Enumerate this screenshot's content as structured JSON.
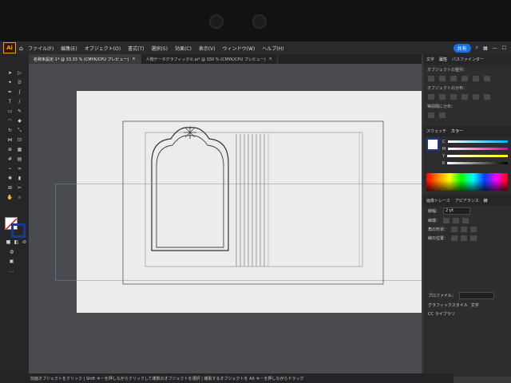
{
  "menubar": {
    "app_logo": "Ai",
    "items": [
      "ファイル(F)",
      "編集(E)",
      "オブジェクト(O)",
      "書式(T)",
      "選択(S)",
      "効果(C)",
      "表示(V)",
      "ウィンドウ(W)",
      "ヘルプ(H)"
    ],
    "share_label": "共有"
  },
  "tabs": [
    {
      "label": "名称未設定-1* @ 33.33 % (CMYK/CPU プレビュー)",
      "active": true
    },
    {
      "label": "人物データグラフィック②.ai* @ 150 % (CMYK/CPU プレビュー)",
      "active": false
    }
  ],
  "right_panel": {
    "top_tabs": [
      "文字",
      "属性",
      "パスファインダー"
    ],
    "align_object_label": "オブジェクトの整列：",
    "distribute_label": "オブジェクトの分布：",
    "distribute_spacing_label": "等間隔に分布：",
    "color_tabs": [
      "スウォッチ",
      "カラー"
    ],
    "color_channels": [
      "C",
      "M",
      "Y",
      "K"
    ],
    "appearance_tabs": [
      "画像トレース",
      "アピアランス",
      "線"
    ],
    "stroke_width_label": "線幅：",
    "stroke_width_value": "2 pt",
    "cap_label": "線端：",
    "corner_label": "角の形状：",
    "align_stroke_label": "線の位置：",
    "profile_label": "プロファイル：",
    "graphic_style_label": "グラフィックスタイル",
    "chars_label": "文字",
    "library_label": "CC ライブラリ"
  },
  "statusbar": {
    "text": "前面オブジェクトをクリック | Shift キーを押しながらクリックして複数のオブジェクトを選択 | 複製するオブジェクトを Alt キーを押しながらドラッグ"
  }
}
